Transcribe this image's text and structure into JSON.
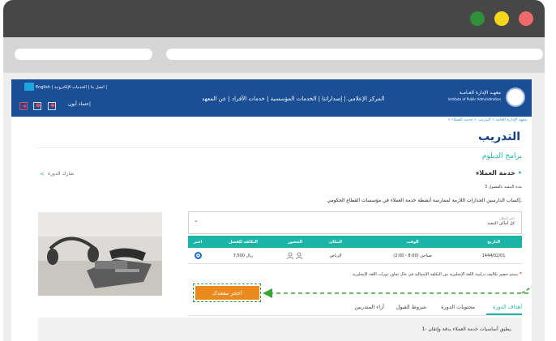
{
  "window": {
    "dots": {
      "green": "#2f8f3a",
      "yellow": "#f3d71b",
      "red": "#ef6b6b"
    }
  },
  "header": {
    "logo_text_ar": "معهـد الإدارة العـامـة",
    "logo_text_en": "Institute of Public Administration",
    "nav_items": [
      "عن المعهد",
      "خدمات الأفراد",
      "الخدمات المؤسسية",
      "إصداراتنا",
      "المركز الإعلامي"
    ],
    "top_links": "English | اتصل بنا | الخدمات الإلكترونية |",
    "sitelogin": "إعتماد أيون"
  },
  "breadcrumb": "« معهد الإدارة العامة » التدريب » خدمة العملاء",
  "page_title": "التدريب",
  "program_type": "برامج الدبلوم",
  "course_name": "خدمة العملاء",
  "share_label": "شارك الدورة",
  "duration": "مدة التنفيذ بالفصول 3",
  "description": "إكساب الدارسين الجدارات اللازمة لممارسة أنشطة خدمة العملاء في مؤسسات القطاع الحكومي.",
  "location_select": {
    "label": "اختر المكان",
    "value": "كل أماكن التنفيذ"
  },
  "table": {
    "headers": [
      "التاريخ",
      "الوقت",
      "المكان",
      "الحضور",
      "التكلفة للفصل",
      "اختر"
    ],
    "row": {
      "date": "1444/02/01",
      "time": "صباحي (8:00 - 2:00)",
      "place": "الرياض",
      "cost": "7,500 ريال"
    }
  },
  "note": "سيتم خصم تكاليف دراسة اللغة الإنجليزية من التكلفة الإجمالية في حال تجاوز دورات اللغة الإنجليزية",
  "book_button": "احجز مقعدك",
  "tabs": [
    "أهداف الدورة",
    "محتويات الدورة",
    "شروط القبول",
    "آراء المتدربين"
  ],
  "goal_item": "1- يطبق أساسيات خدمة العملاء بدقة وإتقان."
}
